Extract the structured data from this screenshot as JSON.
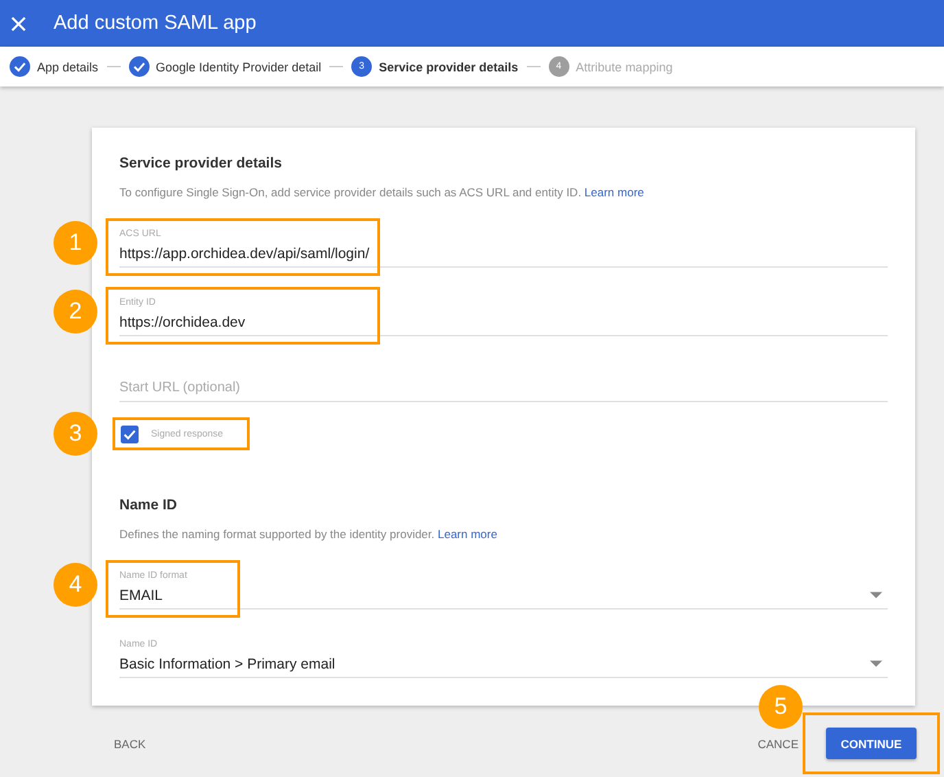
{
  "header": {
    "title": "Add custom SAML app"
  },
  "steps": [
    {
      "kind": "done",
      "label": "App details"
    },
    {
      "kind": "done",
      "label": "Google Identity Provider detail"
    },
    {
      "kind": "current",
      "number": "3",
      "label": "Service provider details"
    },
    {
      "kind": "pending",
      "number": "4",
      "label": "Attribute mapping"
    }
  ],
  "section": {
    "title": "Service provider details",
    "description": "To configure Single Sign-On, add service provider details such as ACS URL and entity ID.",
    "link": "Learn more"
  },
  "fields": [
    {
      "kind": "text",
      "label": "ACS URL",
      "value": "https://app.orchidea.dev/api/saml/login/",
      "annotation": "1"
    },
    {
      "kind": "text",
      "label": "Entity ID",
      "value": "https://orchidea.dev",
      "annotation": "2"
    },
    {
      "kind": "empty",
      "placeholder": "Start URL (optional)"
    },
    {
      "kind": "checkbox",
      "label": "Signed response",
      "checked": true,
      "annotation": "3"
    }
  ],
  "name_id": {
    "title": "Name ID",
    "description": "Defines the naming format supported by the identity provider.",
    "link": "Learn more",
    "fields": [
      {
        "kind": "select",
        "label": "Name ID format",
        "value": "EMAIL",
        "annotation": "4"
      },
      {
        "kind": "select",
        "label": "Name ID",
        "value": "Basic Information > Primary email"
      }
    ]
  },
  "footer": {
    "back": "BACK",
    "cancel": "CANCE",
    "continue": "CONTINUE",
    "annotation": "5"
  }
}
